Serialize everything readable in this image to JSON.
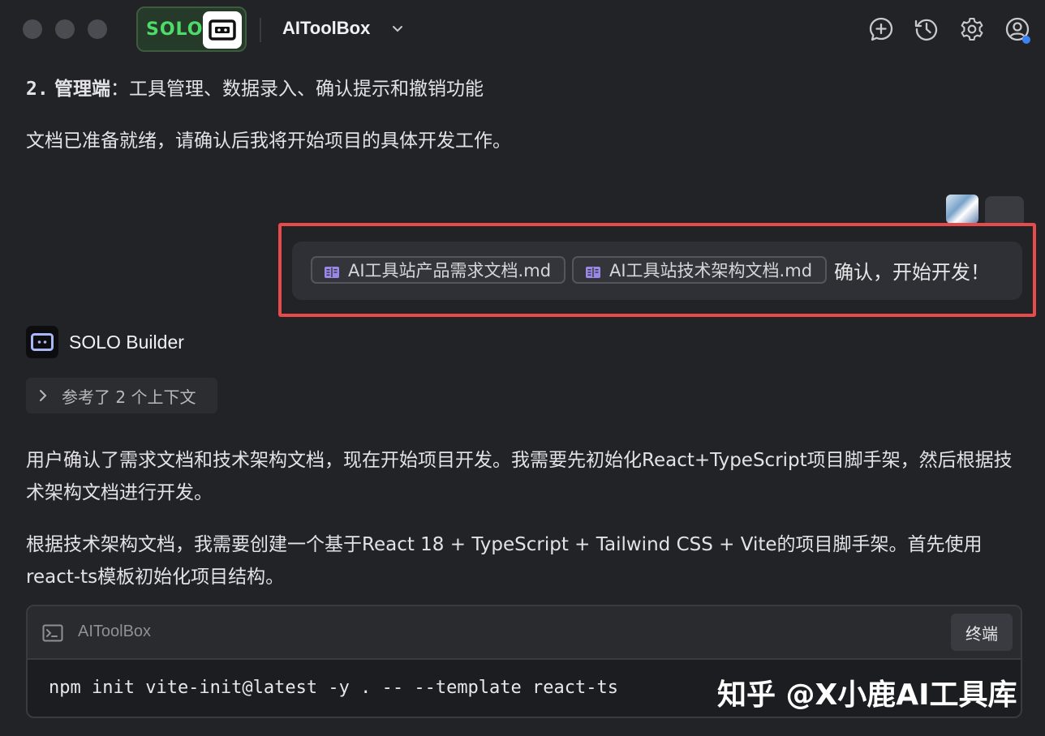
{
  "header": {
    "badge_text": "SOLO",
    "project_name": "AIToolBox",
    "icons": [
      "new-chat-icon",
      "history-icon",
      "gear-icon",
      "account-icon"
    ]
  },
  "messages": {
    "list_item_number": "2.",
    "list_item_bold": "管理端",
    "list_item_text": "：工具管理、数据录入、确认提示和撤销功能",
    "ready_text": "文档已准备就绪，请确认后我将开始项目的具体开发工作。",
    "user_message": {
      "files": [
        "AI工具站产品需求文档.md",
        "AI工具站技术架构文档.md"
      ],
      "text": "确认，开始开发！"
    },
    "builder_name": "SOLO Builder",
    "context_label": "参考了 2 个上下文",
    "reasoning_1": "用户确认了需求文档和技术架构文档，现在开始项目开发。我需要先初始化React+TypeScript项目脚手架，然后根据技术架构文档进行开发。",
    "reasoning_2": "根据技术架构文档，我需要创建一个基于React 18 + TypeScript + Tailwind CSS + Vite的项目脚手架。首先使用react-ts模板初始化项目结构。"
  },
  "terminal": {
    "title": "AIToolBox",
    "button_label": "终端",
    "command": "npm init vite-init@latest -y . -- --template react-ts"
  },
  "watermark": "知乎 @X小鹿AI工具库",
  "colors": {
    "background": "#222327",
    "solo_green": "#4ddb6a",
    "highlight_red": "#e84b4b",
    "notification_blue": "#3b82f6"
  }
}
